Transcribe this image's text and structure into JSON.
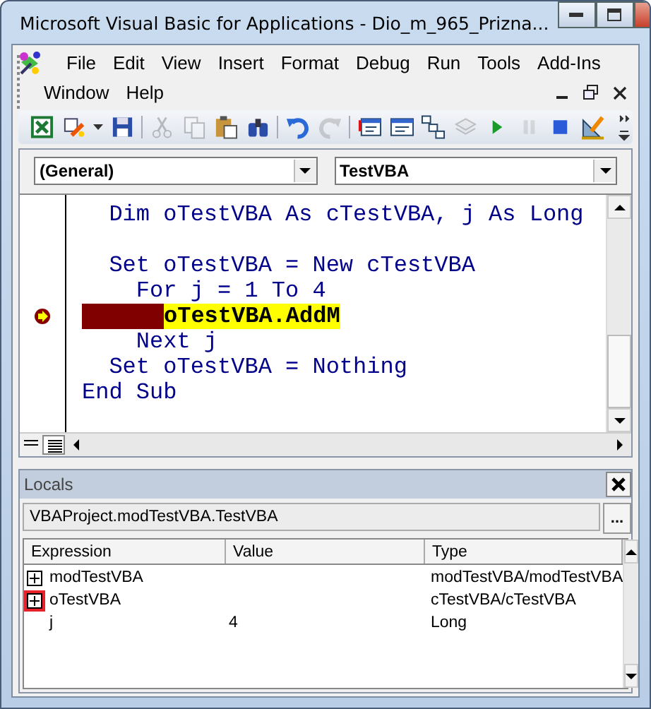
{
  "window": {
    "title": "Microsoft Visual Basic for Applications - Dio_m_965_Prizna..."
  },
  "menu": [
    {
      "label": "File"
    },
    {
      "label": "Edit"
    },
    {
      "label": "View"
    },
    {
      "label": "Insert"
    },
    {
      "label": "Format"
    },
    {
      "label": "Debug"
    },
    {
      "label": "Run"
    },
    {
      "label": "Tools"
    },
    {
      "label": "Add-Ins"
    },
    {
      "label": "Window"
    },
    {
      "label": "Help"
    }
  ],
  "toolbar": [
    {
      "kind": "excel",
      "disabled": false
    },
    {
      "kind": "insert",
      "disabled": false
    },
    {
      "kind": "save",
      "disabled": false
    },
    {
      "kind": "sep"
    },
    {
      "kind": "cut",
      "disabled": true
    },
    {
      "kind": "copy",
      "disabled": true
    },
    {
      "kind": "paste",
      "disabled": false
    },
    {
      "kind": "find",
      "disabled": false
    },
    {
      "kind": "sep"
    },
    {
      "kind": "undo",
      "disabled": false
    },
    {
      "kind": "redo",
      "disabled": true
    },
    {
      "kind": "sep"
    },
    {
      "kind": "form",
      "disabled": false
    },
    {
      "kind": "window",
      "disabled": false
    },
    {
      "kind": "tree",
      "disabled": false
    },
    {
      "kind": "stack",
      "disabled": true
    },
    {
      "kind": "play",
      "disabled": false
    },
    {
      "kind": "pause",
      "disabled": true
    },
    {
      "kind": "stop",
      "disabled": false
    },
    {
      "kind": "design",
      "disabled": false
    }
  ],
  "object_dropdown": {
    "value": "(General)"
  },
  "procedure_dropdown": {
    "value": "TestVBA"
  },
  "code": [
    {
      "current": false,
      "text": "  Dim oTestVBA As cTestVBA, j As Long"
    },
    {
      "current": false
    },
    {
      "current": false,
      "text": "  Set oTestVBA = New cTestVBA"
    },
    {
      "current": false,
      "text": "    For j = 1 To 4"
    },
    {
      "current": true,
      "text": "oTestVBA.AddM"
    },
    {
      "current": false,
      "text": "    Next j"
    },
    {
      "current": false,
      "text": "  Set oTestVBA = Nothing"
    },
    {
      "current": false,
      "text": "End Sub"
    }
  ],
  "locals": {
    "title": "Locals",
    "context": "VBAProject.modTestVBA.TestVBA",
    "context_button": "...",
    "columns": [
      "Expression",
      "Value",
      "Type"
    ],
    "rows": [
      {
        "kind": "node",
        "expanded": false,
        "highlighted": false,
        "expression": "modTestVBA",
        "type": "modTestVBA/modTestVBA"
      },
      {
        "kind": "node",
        "expanded": false,
        "highlighted": true,
        "expression": "oTestVBA",
        "type": "cTestVBA/cTestVBA"
      },
      {
        "kind": "leaf",
        "highlighted": false,
        "expression": "j",
        "value": "4",
        "type": "Long"
      }
    ]
  }
}
